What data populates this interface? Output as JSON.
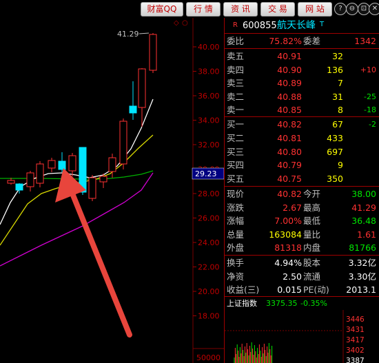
{
  "toolbar": {
    "buttons": [
      "财富QQ",
      "行 情",
      "资 讯",
      "交 易",
      "网 站"
    ],
    "window_icons": [
      "?",
      "⊖",
      "⊡",
      "✕"
    ]
  },
  "chart": {
    "price_axis_labels": [
      "40.00",
      "38.00",
      "36.00",
      "34.00",
      "32.00",
      "30.00",
      "28.00",
      "26.00",
      "24.00",
      "22.00",
      "20.00",
      "18.00"
    ],
    "high_label": "41.29",
    "current_price_tag": "29.23",
    "volume_label": "50000",
    "ma_colors": {
      "white": "#ffffff",
      "yellow": "#d8d800",
      "magenta": "#d000d0",
      "green": "#00b000"
    },
    "up_color": "#ff3232",
    "down_color": "#00e5ff"
  },
  "quote": {
    "code": "600855",
    "name": "航天长峰",
    "weibi": {
      "label": "委比",
      "value": "75.82%",
      "label2": "委差",
      "value2": "1342"
    },
    "asks": [
      {
        "label": "卖五",
        "price": "40.91",
        "vol": "32",
        "chg": ""
      },
      {
        "label": "卖四",
        "price": "40.90",
        "vol": "136",
        "chg": "+10"
      },
      {
        "label": "卖三",
        "price": "40.89",
        "vol": "7",
        "chg": ""
      },
      {
        "label": "卖二",
        "price": "40.88",
        "vol": "31",
        "chg": "-25"
      },
      {
        "label": "卖一",
        "price": "40.85",
        "vol": "8",
        "chg": "-18"
      }
    ],
    "bids": [
      {
        "label": "买一",
        "price": "40.82",
        "vol": "67",
        "chg": "-2"
      },
      {
        "label": "买二",
        "price": "40.81",
        "vol": "433",
        "chg": ""
      },
      {
        "label": "买三",
        "price": "40.80",
        "vol": "697",
        "chg": ""
      },
      {
        "label": "买四",
        "price": "40.79",
        "vol": "9",
        "chg": ""
      },
      {
        "label": "买五",
        "price": "40.75",
        "vol": "350",
        "chg": ""
      }
    ],
    "stats": [
      {
        "l1": "现价",
        "v1": "40.82",
        "l2": "今开",
        "v2": "38.00"
      },
      {
        "l1": "涨跌",
        "v1": "2.67",
        "l2": "最高",
        "v2": "41.29"
      },
      {
        "l1": "涨幅",
        "v1": "7.00%",
        "l2": "最低",
        "v2": "36.48"
      },
      {
        "l1": "总量",
        "v1": "163084",
        "l2": "量比",
        "v2": "1.61"
      },
      {
        "l1": "外盘",
        "v1": "81318",
        "l2": "内盘",
        "v2": "81766"
      }
    ],
    "fin": [
      {
        "l1": "换手",
        "v1": "4.94%",
        "l2": "股本",
        "v2": "3.32亿"
      },
      {
        "l1": "净资",
        "v1": "2.50",
        "l2": "流通",
        "v2": "3.30亿"
      },
      {
        "l1": "收益(三)",
        "v1": "0.015",
        "l2": "PE(动)",
        "v2": "2013.1"
      }
    ]
  },
  "index": {
    "name": "上证指数",
    "value": "3375.35",
    "change": "-0.35%",
    "axis": [
      "3446",
      "3431",
      "3417",
      "3402",
      "3387"
    ]
  }
}
